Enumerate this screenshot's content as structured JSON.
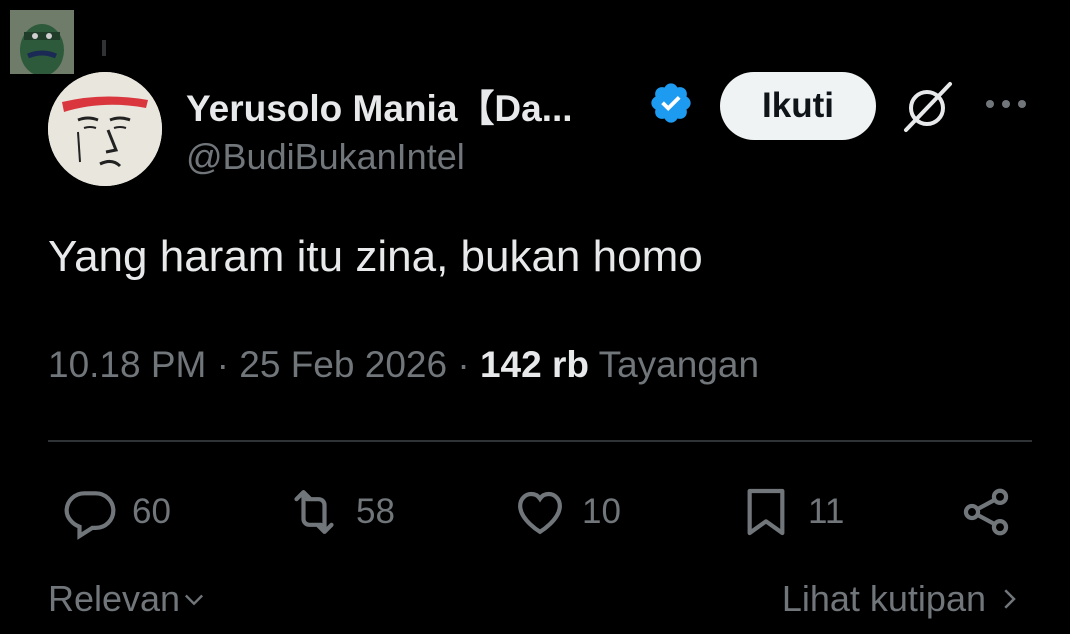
{
  "header": {
    "display_name": "Yerusolo Mania【Da...",
    "handle": "@BudiBukanIntel",
    "follow_label": "Ikuti"
  },
  "tweet": {
    "text": "Yang haram itu zina, bukan homo",
    "time": "10.18 PM",
    "separator": "·",
    "date": "25 Feb 2026",
    "views_count": "142 rb",
    "views_label": "Tayangan"
  },
  "actions": {
    "replies": "60",
    "reposts": "58",
    "likes": "10",
    "bookmarks": "11"
  },
  "footer": {
    "sort_label": "Relevan",
    "quotes_label": "Lihat kutipan"
  },
  "icons": [
    "verified-badge-icon",
    "grok-icon",
    "more-icon",
    "reply-icon",
    "repost-icon",
    "like-icon",
    "bookmark-icon",
    "share-icon",
    "chevron-down-icon",
    "chevron-right-icon"
  ],
  "colors": {
    "background": "#000000",
    "text": "#e7e9ea",
    "secondary": "#71767b",
    "verified": "#1d9bf0",
    "button_bg": "#eff3f4"
  }
}
